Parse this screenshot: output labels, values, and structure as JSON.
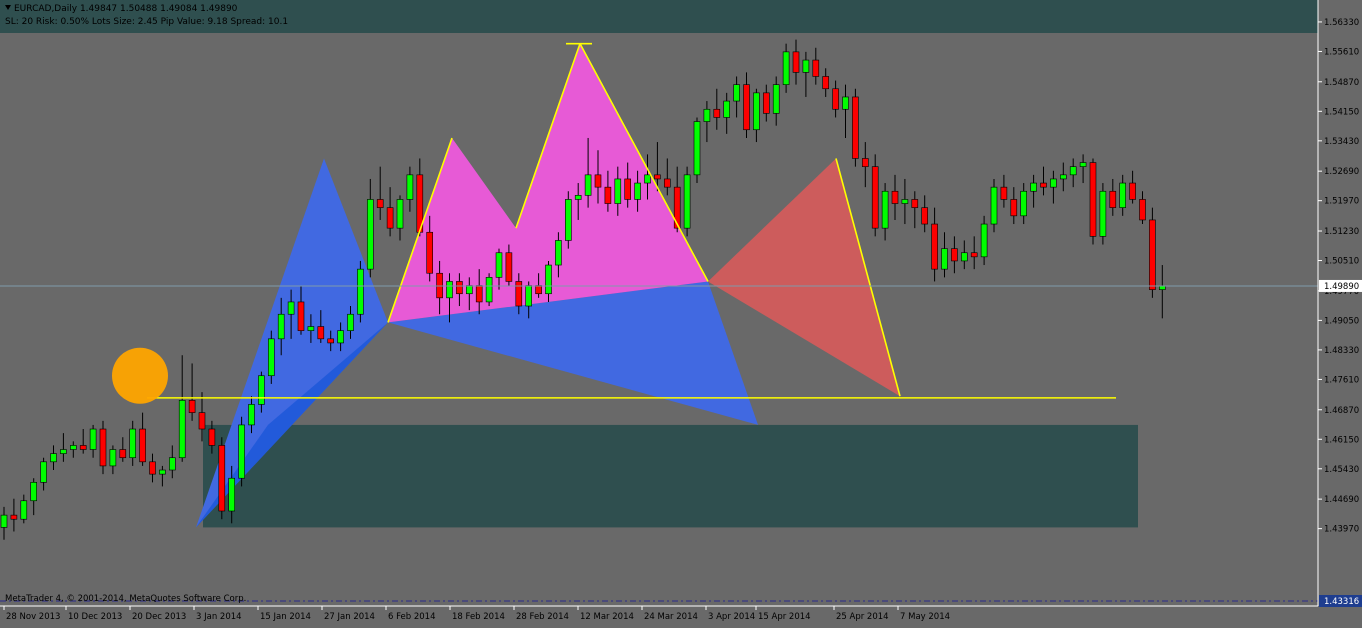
{
  "header": {
    "symbol_line": "EURCAD,Daily  1.49847 1.50488 1.49084 1.49890",
    "info_line": "SL: 20 Risk: 0.50%  Lots Size: 2.45 Pip Value: 9.18 Spread: 10.1"
  },
  "footer": {
    "copyright": "MetaTrader 4, © 2001-2014, MetaQuotes Software Corp."
  },
  "colors": {
    "background": "#696969",
    "bull": "#00ff00",
    "bear": "#ff0000",
    "blue_pattern": "#4169e1",
    "magenta_pattern": "#e75ad6",
    "red_pattern": "#cd5c5c",
    "zone": "#2f4f4f",
    "level": "#ffff00",
    "circle": "#ffa500"
  },
  "chart_data": {
    "type": "candlestick",
    "symbol": "EURCAD",
    "timeframe": "Daily",
    "ylim": [
      1.4301,
      1.5667
    ],
    "y_ticks": [
      "1.56330",
      "1.55610",
      "1.54870",
      "1.54150",
      "1.53430",
      "1.52690",
      "1.51970",
      "1.51230",
      "1.50510",
      "1.49770",
      "1.49050",
      "1.48330",
      "1.47610",
      "1.46870",
      "1.46150",
      "1.45430",
      "1.44690",
      "1.43970"
    ],
    "x_labels": [
      "28 Nov 2013",
      "10 Dec 2013",
      "20 Dec 2013",
      "3 Jan 2014",
      "15 Jan 2014",
      "27 Jan 2014",
      "6 Feb 2014",
      "18 Feb 2014",
      "28 Feb 2014",
      "12 Mar 2014",
      "24 Mar 2014",
      "3 Apr 2014",
      "15 Apr 2014",
      "25 Apr 2014",
      "7 May 2014"
    ],
    "bid_label": "1.49890",
    "bid_level": 1.4989,
    "bottom_label": "1.43316",
    "bottom_level": 1.4331,
    "ohlc": [
      [
        1.44,
        1.445,
        1.437,
        1.443
      ],
      [
        1.443,
        1.447,
        1.439,
        1.442
      ],
      [
        1.442,
        1.448,
        1.441,
        1.4465
      ],
      [
        1.4465,
        1.452,
        1.443,
        1.451
      ],
      [
        1.451,
        1.457,
        1.449,
        1.456
      ],
      [
        1.456,
        1.46,
        1.454,
        1.458
      ],
      [
        1.458,
        1.463,
        1.456,
        1.459
      ],
      [
        1.459,
        1.461,
        1.457,
        1.46
      ],
      [
        1.46,
        1.464,
        1.458,
        1.459
      ],
      [
        1.459,
        1.465,
        1.457,
        1.464
      ],
      [
        1.464,
        1.466,
        1.453,
        1.455
      ],
      [
        1.455,
        1.46,
        1.453,
        1.459
      ],
      [
        1.459,
        1.462,
        1.456,
        1.457
      ],
      [
        1.457,
        1.466,
        1.455,
        1.464
      ],
      [
        1.464,
        1.468,
        1.455,
        1.456
      ],
      [
        1.456,
        1.458,
        1.451,
        1.453
      ],
      [
        1.453,
        1.455,
        1.45,
        1.454
      ],
      [
        1.454,
        1.46,
        1.452,
        1.457
      ],
      [
        1.457,
        1.482,
        1.456,
        1.471
      ],
      [
        1.471,
        1.48,
        1.466,
        1.468
      ],
      [
        1.468,
        1.473,
        1.461,
        1.464
      ],
      [
        1.464,
        1.466,
        1.458,
        1.46
      ],
      [
        1.46,
        1.462,
        1.442,
        1.444
      ],
      [
        1.444,
        1.455,
        1.441,
        1.452
      ],
      [
        1.452,
        1.467,
        1.45,
        1.465
      ],
      [
        1.465,
        1.472,
        1.463,
        1.47
      ],
      [
        1.47,
        1.478,
        1.468,
        1.477
      ],
      [
        1.477,
        1.488,
        1.475,
        1.486
      ],
      [
        1.486,
        1.496,
        1.482,
        1.492
      ],
      [
        1.492,
        1.498,
        1.486,
        1.495
      ],
      [
        1.495,
        1.499,
        1.487,
        1.488
      ],
      [
        1.488,
        1.492,
        1.485,
        1.489
      ],
      [
        1.489,
        1.493,
        1.485,
        1.486
      ],
      [
        1.486,
        1.488,
        1.483,
        1.485
      ],
      [
        1.485,
        1.49,
        1.483,
        1.488
      ],
      [
        1.488,
        1.494,
        1.486,
        1.492
      ],
      [
        1.492,
        1.505,
        1.49,
        1.503
      ],
      [
        1.503,
        1.525,
        1.501,
        1.52
      ],
      [
        1.52,
        1.528,
        1.515,
        1.518
      ],
      [
        1.518,
        1.523,
        1.511,
        1.513
      ],
      [
        1.513,
        1.521,
        1.51,
        1.52
      ],
      [
        1.52,
        1.528,
        1.517,
        1.526
      ],
      [
        1.526,
        1.53,
        1.511,
        1.512
      ],
      [
        1.512,
        1.516,
        1.5,
        1.502
      ],
      [
        1.502,
        1.505,
        1.492,
        1.496
      ],
      [
        1.496,
        1.502,
        1.49,
        1.5
      ],
      [
        1.5,
        1.502,
        1.494,
        1.497
      ],
      [
        1.497,
        1.501,
        1.493,
        1.499
      ],
      [
        1.499,
        1.503,
        1.492,
        1.495
      ],
      [
        1.495,
        1.502,
        1.494,
        1.501
      ],
      [
        1.501,
        1.508,
        1.498,
        1.507
      ],
      [
        1.507,
        1.509,
        1.499,
        1.5
      ],
      [
        1.5,
        1.502,
        1.492,
        1.494
      ],
      [
        1.494,
        1.5,
        1.491,
        1.499
      ],
      [
        1.499,
        1.502,
        1.496,
        1.497
      ],
      [
        1.497,
        1.505,
        1.495,
        1.504
      ],
      [
        1.504,
        1.512,
        1.501,
        1.51
      ],
      [
        1.51,
        1.522,
        1.508,
        1.52
      ],
      [
        1.52,
        1.524,
        1.515,
        1.521
      ],
      [
        1.521,
        1.535,
        1.518,
        1.526
      ],
      [
        1.526,
        1.532,
        1.519,
        1.523
      ],
      [
        1.523,
        1.527,
        1.517,
        1.519
      ],
      [
        1.519,
        1.528,
        1.516,
        1.525
      ],
      [
        1.525,
        1.529,
        1.518,
        1.52
      ],
      [
        1.52,
        1.527,
        1.517,
        1.524
      ],
      [
        1.524,
        1.531,
        1.52,
        1.526
      ],
      [
        1.526,
        1.534,
        1.522,
        1.525
      ],
      [
        1.525,
        1.53,
        1.521,
        1.523
      ],
      [
        1.523,
        1.528,
        1.512,
        1.513
      ],
      [
        1.513,
        1.528,
        1.511,
        1.526
      ],
      [
        1.526,
        1.54,
        1.524,
        1.539
      ],
      [
        1.539,
        1.544,
        1.534,
        1.542
      ],
      [
        1.542,
        1.547,
        1.537,
        1.54
      ],
      [
        1.54,
        1.546,
        1.536,
        1.544
      ],
      [
        1.544,
        1.55,
        1.54,
        1.548
      ],
      [
        1.548,
        1.551,
        1.535,
        1.537
      ],
      [
        1.537,
        1.547,
        1.534,
        1.546
      ],
      [
        1.546,
        1.548,
        1.539,
        1.541
      ],
      [
        1.541,
        1.55,
        1.538,
        1.548
      ],
      [
        1.548,
        1.558,
        1.546,
        1.556
      ],
      [
        1.556,
        1.559,
        1.548,
        1.551
      ],
      [
        1.551,
        1.556,
        1.545,
        1.554
      ],
      [
        1.554,
        1.557,
        1.548,
        1.55
      ],
      [
        1.55,
        1.552,
        1.545,
        1.547
      ],
      [
        1.547,
        1.549,
        1.54,
        1.542
      ],
      [
        1.542,
        1.548,
        1.535,
        1.545
      ],
      [
        1.545,
        1.547,
        1.528,
        1.53
      ],
      [
        1.53,
        1.534,
        1.523,
        1.528
      ],
      [
        1.528,
        1.531,
        1.511,
        1.513
      ],
      [
        1.513,
        1.524,
        1.51,
        1.522
      ],
      [
        1.522,
        1.526,
        1.515,
        1.519
      ],
      [
        1.519,
        1.525,
        1.514,
        1.52
      ],
      [
        1.52,
        1.522,
        1.513,
        1.518
      ],
      [
        1.518,
        1.521,
        1.512,
        1.514
      ],
      [
        1.514,
        1.518,
        1.5,
        1.503
      ],
      [
        1.503,
        1.512,
        1.501,
        1.508
      ],
      [
        1.508,
        1.511,
        1.502,
        1.505
      ],
      [
        1.505,
        1.51,
        1.503,
        1.507
      ],
      [
        1.507,
        1.511,
        1.503,
        1.506
      ],
      [
        1.506,
        1.516,
        1.504,
        1.514
      ],
      [
        1.514,
        1.525,
        1.512,
        1.523
      ],
      [
        1.523,
        1.526,
        1.518,
        1.52
      ],
      [
        1.52,
        1.523,
        1.514,
        1.516
      ],
      [
        1.516,
        1.524,
        1.514,
        1.522
      ],
      [
        1.522,
        1.526,
        1.518,
        1.524
      ],
      [
        1.524,
        1.528,
        1.521,
        1.523
      ],
      [
        1.523,
        1.527,
        1.519,
        1.525
      ],
      [
        1.525,
        1.529,
        1.522,
        1.526
      ],
      [
        1.526,
        1.53,
        1.523,
        1.528
      ],
      [
        1.528,
        1.531,
        1.524,
        1.529
      ],
      [
        1.529,
        1.53,
        1.509,
        1.511
      ],
      [
        1.511,
        1.524,
        1.509,
        1.522
      ],
      [
        1.522,
        1.525,
        1.516,
        1.518
      ],
      [
        1.518,
        1.526,
        1.516,
        1.524
      ],
      [
        1.524,
        1.527,
        1.519,
        1.52
      ],
      [
        1.52,
        1.522,
        1.514,
        1.515
      ],
      [
        1.515,
        1.518,
        1.496,
        1.498
      ],
      [
        1.498,
        1.504,
        1.491,
        1.4989
      ]
    ],
    "patterns": [
      {
        "name": "blue-pattern",
        "points": [
          [
            "3 Jan 2014",
            1.44
          ],
          [
            "27 Jan 2014",
            1.53
          ],
          [
            "6 Feb 2014",
            1.49
          ],
          [
            "3 Apr 2014",
            1.5
          ],
          [
            "15 Apr 2014",
            1.465
          ]
        ]
      },
      {
        "name": "magenta-pattern",
        "points": [
          [
            "6 Feb 2014",
            1.49
          ],
          [
            "18 Feb 2014",
            1.535
          ],
          [
            "28 Feb 2014",
            1.513
          ],
          [
            "12 Mar 2014",
            1.558
          ],
          [
            "3 Apr 2014",
            1.5
          ]
        ]
      },
      {
        "name": "red-pattern",
        "points": [
          [
            "3 Apr 2014",
            1.5
          ],
          [
            "25 Apr 2014",
            1.53
          ],
          [
            "7 May 2014",
            1.472
          ]
        ]
      }
    ],
    "level_line": 1.4716,
    "zone": [
      1.44,
      1.465
    ]
  }
}
